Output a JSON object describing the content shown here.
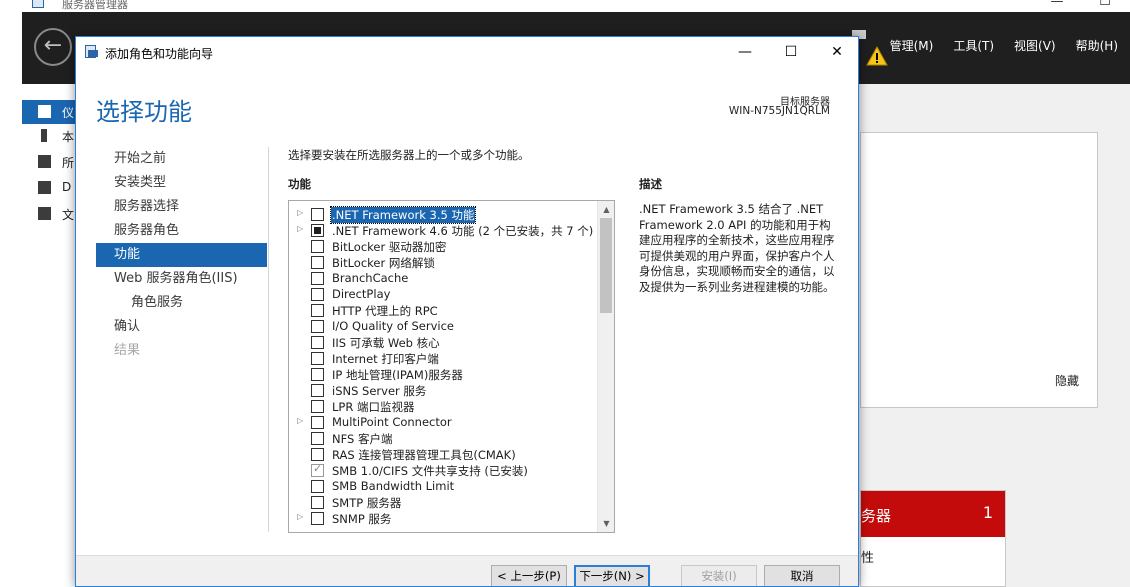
{
  "background": {
    "window_title": "服务器管理器",
    "menus": [
      "管理(M)",
      "工具(T)",
      "视图(V)",
      "帮助(H)"
    ],
    "sidebar": [
      {
        "label": "仪",
        "active": true
      },
      {
        "label": "本",
        "active": false
      },
      {
        "label": "所",
        "active": false
      },
      {
        "label": "D",
        "active": false
      },
      {
        "label": "文",
        "active": false
      }
    ],
    "hide_label": "隐藏",
    "tile": {
      "title": "务器",
      "count": "1",
      "row": "性"
    }
  },
  "dialog": {
    "title": "添加角色和功能向导",
    "page_title": "选择功能",
    "target_label": "目标服务器",
    "target_server": "WIN-N755JN1QRLM",
    "steps": [
      {
        "label": "开始之前",
        "state": "normal"
      },
      {
        "label": "安装类型",
        "state": "normal"
      },
      {
        "label": "服务器选择",
        "state": "normal"
      },
      {
        "label": "服务器角色",
        "state": "normal"
      },
      {
        "label": "功能",
        "state": "active"
      },
      {
        "label": "Web 服务器角色(IIS)",
        "state": "normal"
      },
      {
        "label": "角色服务",
        "state": "sub"
      },
      {
        "label": "确认",
        "state": "normal"
      },
      {
        "label": "结果",
        "state": "disabled"
      }
    ],
    "instruction": "选择要安装在所选服务器上的一个或多个功能。",
    "features_header": "功能",
    "features": [
      {
        "label": ".NET Framework 3.5 功能",
        "expandable": true,
        "state": "unchecked",
        "selected": true
      },
      {
        "label": ".NET Framework 4.6 功能 (2 个已安装，共 7 个)",
        "expandable": true,
        "state": "partial",
        "selected": false
      },
      {
        "label": "BitLocker 驱动器加密",
        "expandable": false,
        "state": "unchecked",
        "selected": false
      },
      {
        "label": "BitLocker 网络解锁",
        "expandable": false,
        "state": "unchecked",
        "selected": false
      },
      {
        "label": "BranchCache",
        "expandable": false,
        "state": "unchecked",
        "selected": false
      },
      {
        "label": "DirectPlay",
        "expandable": false,
        "state": "unchecked",
        "selected": false
      },
      {
        "label": "HTTP 代理上的 RPC",
        "expandable": false,
        "state": "unchecked",
        "selected": false
      },
      {
        "label": "I/O Quality of Service",
        "expandable": false,
        "state": "unchecked",
        "selected": false
      },
      {
        "label": "IIS 可承载 Web 核心",
        "expandable": false,
        "state": "unchecked",
        "selected": false
      },
      {
        "label": "Internet 打印客户端",
        "expandable": false,
        "state": "unchecked",
        "selected": false
      },
      {
        "label": "IP 地址管理(IPAM)服务器",
        "expandable": false,
        "state": "unchecked",
        "selected": false
      },
      {
        "label": "iSNS Server 服务",
        "expandable": false,
        "state": "unchecked",
        "selected": false
      },
      {
        "label": "LPR 端口监视器",
        "expandable": false,
        "state": "unchecked",
        "selected": false
      },
      {
        "label": "MultiPoint Connector",
        "expandable": true,
        "state": "unchecked",
        "selected": false
      },
      {
        "label": "NFS 客户端",
        "expandable": false,
        "state": "unchecked",
        "selected": false
      },
      {
        "label": "RAS 连接管理器管理工具包(CMAK)",
        "expandable": false,
        "state": "unchecked",
        "selected": false
      },
      {
        "label": "SMB 1.0/CIFS 文件共享支持 (已安装)",
        "expandable": false,
        "state": "checked-disabled",
        "selected": false
      },
      {
        "label": "SMB Bandwidth Limit",
        "expandable": false,
        "state": "unchecked",
        "selected": false
      },
      {
        "label": "SMTP 服务器",
        "expandable": false,
        "state": "unchecked",
        "selected": false
      },
      {
        "label": "SNMP 服务",
        "expandable": true,
        "state": "unchecked",
        "selected": false
      }
    ],
    "description_header": "描述",
    "description": ".NET Framework 3.5 结合了 .NET Framework 2.0 API 的功能和用于构建应用程序的全新技术，这些应用程序可提供美观的用户界面，保护客户个人身份信息，实现顺畅而安全的通信，以及提供为一系列业务进程建模的功能。",
    "buttons": {
      "prev": "< 上一步(P)",
      "next": "下一步(N) >",
      "install": "安装(I)",
      "cancel": "取消"
    }
  },
  "colors": {
    "accent": "#1a66b1",
    "alert": "#c40b0b",
    "nav_bg": "#1f1f1f"
  }
}
